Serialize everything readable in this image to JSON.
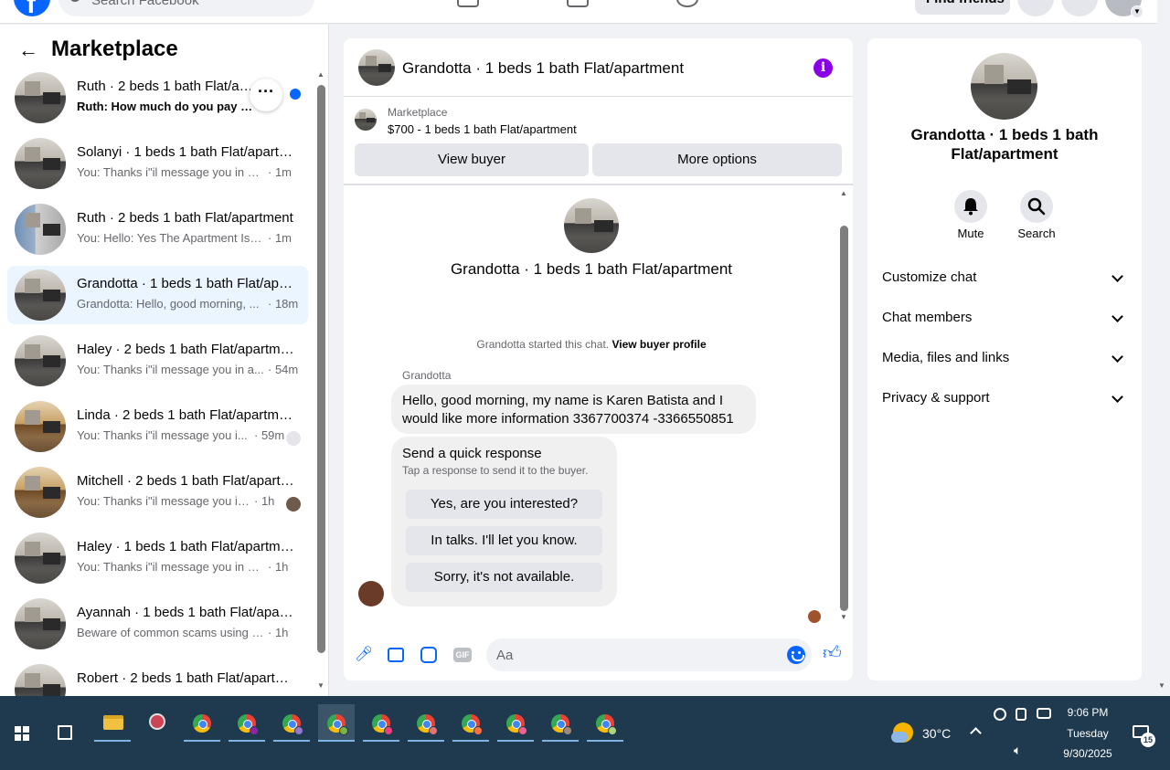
{
  "topbar": {
    "search_placeholder": "Search Facebook",
    "find_friends": "Find friends"
  },
  "sidebar": {
    "title": "Marketplace",
    "conversations": [
      {
        "name": "Ruth · 2 beds 1 bath Flat/apartment",
        "preview": "Ruth: How much do you pay and",
        "time": "",
        "unread": true,
        "photo": "gray"
      },
      {
        "name": "Solanyi · 1 beds 1 bath Flat/apartment",
        "preview": "You: Thanks i\"il message you in a ...",
        "time": "· 1m",
        "unread": false,
        "photo": "gray"
      },
      {
        "name": "Ruth · 2 beds 1 bath Flat/apartment",
        "preview": "You: Hello: Yes The Apartment Is St...",
        "time": "· 1m",
        "unread": false,
        "photo": "blue"
      },
      {
        "name": "Grandotta · 1 beds 1 bath Flat/apartment",
        "preview": "Grandotta: Hello, good morning, ...",
        "time": "· 18m",
        "unread": false,
        "photo": "gray",
        "active": true
      },
      {
        "name": "Haley · 2 beds 1 bath Flat/apartment",
        "preview": "You: Thanks i\"il message you in a...",
        "time": "· 54m",
        "unread": false,
        "photo": "gray"
      },
      {
        "name": "Linda · 2 beds 1 bath Flat/apartment",
        "preview": "You: Thanks i\"il message you i...",
        "time": "· 59m",
        "unread": false,
        "photo": "warm",
        "seen": "default-avatar"
      },
      {
        "name": "Mitchell · 2 beds 1 bath Flat/apartment",
        "preview": "You: Thanks i\"il message you in ...",
        "time": "· 1h",
        "unread": false,
        "photo": "warm",
        "seen": "user-avatar"
      },
      {
        "name": "Haley · 1 beds 1 bath Flat/apartment",
        "preview": "You: Thanks i\"il message you in a ...",
        "time": "· 1h",
        "unread": false,
        "photo": "gray"
      },
      {
        "name": "Ayannah · 1 beds 1 bath Flat/apartment",
        "preview": "Beware of common scams using pa...",
        "time": "· 1h",
        "unread": false,
        "photo": "gray"
      },
      {
        "name": "Robert · 2 beds 1 bath Flat/apartment",
        "preview": "",
        "time": "",
        "unread": false,
        "photo": "gray"
      }
    ]
  },
  "chat": {
    "title": "Grandotta · 1 beds 1 bath Flat/apartment",
    "listing_source": "Marketplace",
    "listing_item": "$700 - 1 beds 1 bath Flat/apartment",
    "view_buyer": "View buyer",
    "more_options": "More options",
    "intro_name": "Grandotta · 1 beds 1 bath Flat/apartment",
    "started_text": "Grandotta started this chat.",
    "view_buyer_profile": "View buyer profile",
    "sender": "Grandotta",
    "message": "Hello, good morning, my name is Karen Batista and I would like more information 3367700374 -3366550851",
    "quick_title": "Send a quick response",
    "quick_sub": "Tap a response to send it to the buyer.",
    "quick_responses": [
      "Yes, are you interested?",
      "In talks. I'll let you know.",
      "Sorry, it's not available."
    ],
    "composer_placeholder": "Aa",
    "composer_icons": [
      "microphone-icon",
      "photo-icon",
      "sticker-icon",
      "gif-icon"
    ]
  },
  "right_panel": {
    "name": "Grandotta · 1 beds 1 bath Flat/apartment",
    "actions": [
      {
        "label": "Mute",
        "icon": "bell-icon"
      },
      {
        "label": "Search",
        "icon": "search-icon"
      }
    ],
    "sections": [
      "Customize chat",
      "Chat members",
      "Media, files and links",
      "Privacy & support"
    ]
  },
  "taskbar": {
    "temperature": "30°C",
    "time": "9:06 PM",
    "day": "Tuesday",
    "date": "9/30/2025",
    "notification_count": "15"
  },
  "colors": {
    "brand": "#0866ff",
    "info": "#8a00e6",
    "active_row": "#ebf5ff",
    "taskbar": "#1f3a4f"
  }
}
